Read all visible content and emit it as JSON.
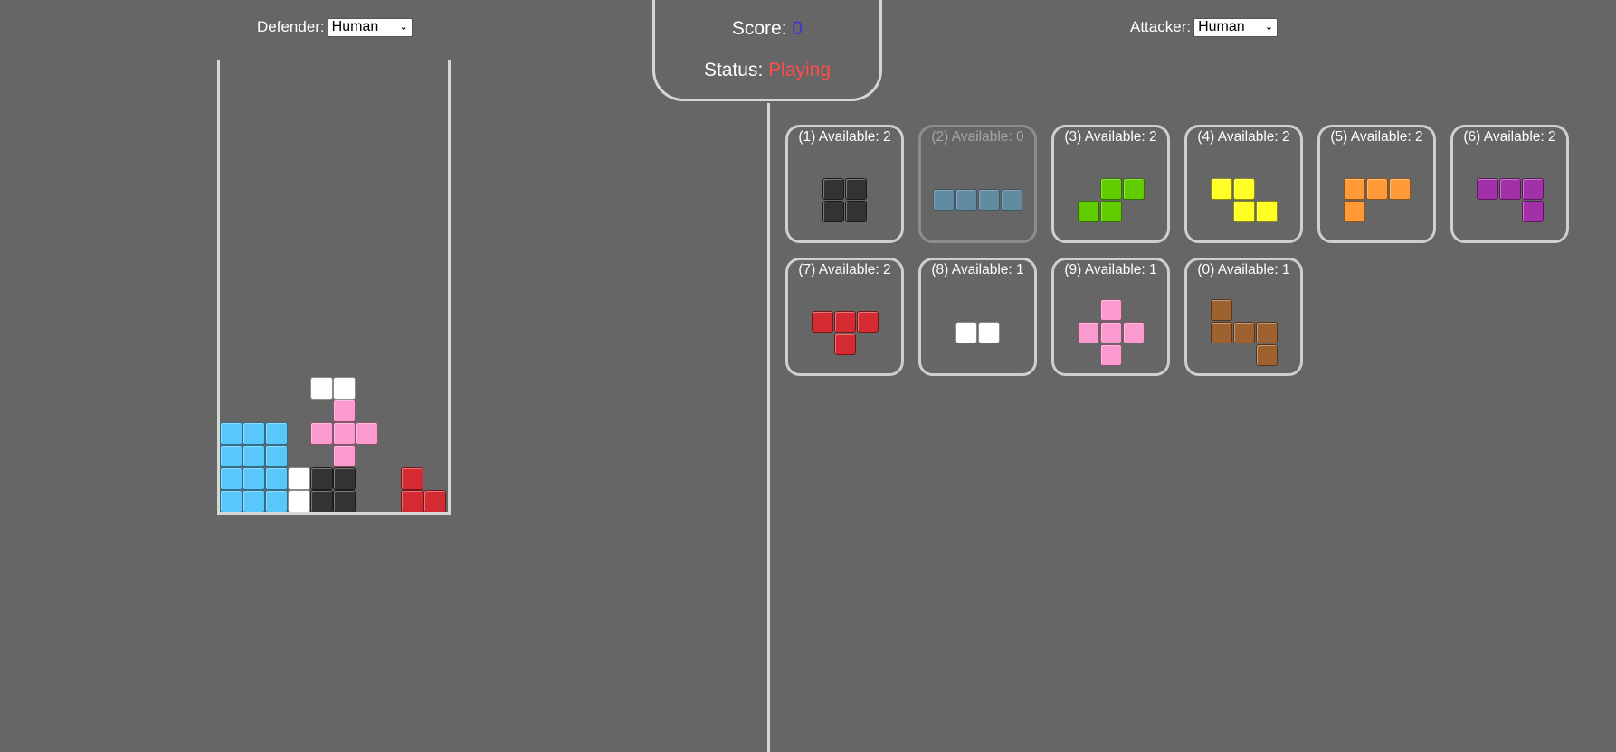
{
  "defender": {
    "label": "Defender:",
    "selected": "Human"
  },
  "attacker": {
    "label": "Attacker:",
    "selected": "Human"
  },
  "scoreboard": {
    "score_label": "Score:",
    "score_value": "0",
    "status_label": "Status:",
    "status_value": "Playing",
    "score_color": "#3b32d9",
    "status_color": "#ff4d4d"
  },
  "board": {
    "columns": 10,
    "rows_filled_from_bottom": [
      [
        "cyan",
        "cyan",
        "cyan",
        "white",
        "dark",
        "dark",
        null,
        null,
        "red",
        "red"
      ],
      [
        "cyan",
        "cyan",
        "cyan",
        "white",
        "dark",
        "dark",
        null,
        null,
        "red",
        null
      ],
      [
        "cyan",
        "cyan",
        "cyan",
        null,
        null,
        "pink",
        null,
        null,
        null,
        null
      ],
      [
        "cyan",
        "cyan",
        "cyan",
        null,
        "pink",
        "pink",
        "pink",
        null,
        null,
        null
      ],
      [
        null,
        null,
        null,
        null,
        null,
        "pink",
        null,
        null,
        null,
        null
      ],
      [
        null,
        null,
        null,
        null,
        "white",
        "white",
        null,
        null,
        null,
        null
      ]
    ],
    "colors": {
      "cyan": "#5ac7fa",
      "white": "#ffffff",
      "dark": "#333333",
      "pink": "#fb9ace",
      "red": "#d42b32"
    }
  },
  "pieces": [
    {
      "label": "(1) Available: 2",
      "available": 2,
      "color": "#333333",
      "shape": [
        [
          1,
          1
        ],
        [
          1,
          1
        ]
      ],
      "disabled": false
    },
    {
      "label": "(2) Available: 0",
      "available": 0,
      "color": "#5f98b4",
      "shape": [
        [
          1,
          1,
          1,
          1
        ]
      ],
      "disabled": true
    },
    {
      "label": "(3) Available: 2",
      "available": 2,
      "color": "#61cc00",
      "shape": [
        [
          0,
          1,
          1
        ],
        [
          1,
          1,
          0
        ]
      ],
      "disabled": false
    },
    {
      "label": "(4) Available: 2",
      "available": 2,
      "color": "#ffff26",
      "shape": [
        [
          1,
          1,
          0
        ],
        [
          0,
          1,
          1
        ]
      ],
      "disabled": false
    },
    {
      "label": "(5) Available: 2",
      "available": 2,
      "color": "#ff9a37",
      "shape": [
        [
          1,
          1,
          1
        ],
        [
          1,
          0,
          0
        ]
      ],
      "disabled": false
    },
    {
      "label": "(6) Available: 2",
      "available": 2,
      "color": "#a230a6",
      "shape": [
        [
          1,
          1,
          1
        ],
        [
          0,
          0,
          1
        ]
      ],
      "disabled": false
    },
    {
      "label": "(7) Available: 2",
      "available": 2,
      "color": "#d42b32",
      "shape": [
        [
          1,
          1,
          1
        ],
        [
          0,
          1,
          0
        ]
      ],
      "disabled": false
    },
    {
      "label": "(8) Available: 1",
      "available": 1,
      "color": "#ffffff",
      "shape": [
        [
          1,
          1
        ]
      ],
      "disabled": false
    },
    {
      "label": "(9) Available: 1",
      "available": 1,
      "color": "#fb9ace",
      "shape": [
        [
          0,
          1,
          0
        ],
        [
          1,
          1,
          1
        ],
        [
          0,
          1,
          0
        ]
      ],
      "disabled": false
    },
    {
      "label": "(0) Available: 1",
      "available": 1,
      "color": "#9e6130",
      "shape": [
        [
          1,
          0,
          0
        ],
        [
          1,
          1,
          1
        ],
        [
          0,
          0,
          1
        ]
      ],
      "disabled": false
    }
  ]
}
